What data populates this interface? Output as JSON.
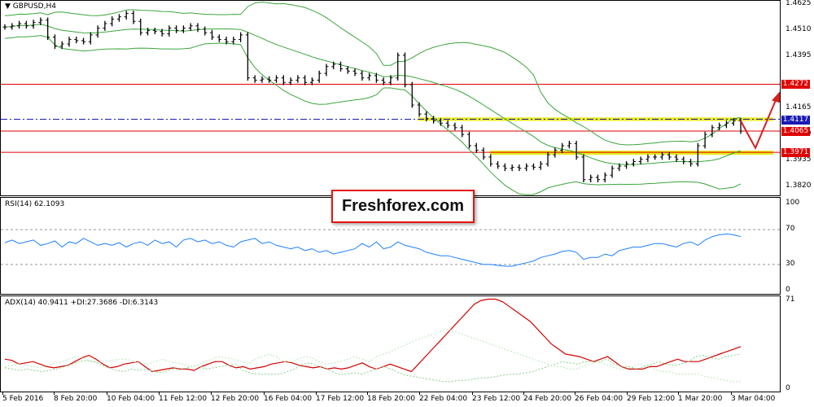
{
  "chart_data": [
    {
      "type": "candlestick",
      "title": "GBPUSD,H4",
      "x_labels": [
        "5 Feb 2016",
        "8 Feb 20:00",
        "10 Feb 04:00",
        "11 Feb 12:00",
        "12 Feb 20:00",
        "16 Feb 04:00",
        "17 Feb 12:00",
        "18 Feb 20:00",
        "22 Feb 04:00",
        "23 Feb 12:00",
        "24 Feb 20:00",
        "26 Feb 04:00",
        "29 Feb 12:00",
        "1 Mar 20:00",
        "3 Mar 04:00"
      ],
      "y_ticks": [
        1.4625,
        1.451,
        1.4395,
        1.4165,
        1.405,
        1.3935,
        1.382
      ],
      "ylim": [
        1.3795,
        1.463
      ],
      "close": [
        1.4525,
        1.453,
        1.454,
        1.453,
        1.4545,
        1.4555,
        1.448,
        1.444,
        1.445,
        1.447,
        1.4465,
        1.446,
        1.449,
        1.452,
        1.454,
        1.456,
        1.457,
        1.4585,
        1.455,
        1.45,
        1.451,
        1.4505,
        1.4495,
        1.452,
        1.451,
        1.452,
        1.453,
        1.4515,
        1.45,
        1.448,
        1.447,
        1.446,
        1.447,
        1.449,
        1.43,
        1.429,
        1.4295,
        1.429,
        1.43,
        1.428,
        1.429,
        1.43,
        1.428,
        1.429,
        1.432,
        1.435,
        1.436,
        1.434,
        1.433,
        1.432,
        1.43,
        1.431,
        1.429,
        1.428,
        1.43,
        1.44,
        1.427,
        1.418,
        1.414,
        1.412,
        1.411,
        1.41,
        1.409,
        1.408,
        1.405,
        1.4,
        1.398,
        1.395,
        1.392,
        1.391,
        1.39,
        1.3905,
        1.39,
        1.391,
        1.3905,
        1.392,
        1.396,
        1.398,
        1.4,
        1.401,
        1.395,
        1.385,
        1.386,
        1.385,
        1.387,
        1.39,
        1.391,
        1.392,
        1.393,
        1.394,
        1.395,
        1.395,
        1.396,
        1.395,
        1.394,
        1.393,
        1.392,
        1.4,
        1.405,
        1.408,
        1.409,
        1.41,
        1.411,
        1.4065
      ],
      "horizontal_lines": [
        {
          "value": 1.4272,
          "style": "solid",
          "color": "#e00000",
          "tag": "1.4272"
        },
        {
          "value": 1.4117,
          "style": "dashdot",
          "color": "#1a1ab3",
          "tag": "1.4117"
        },
        {
          "value": 1.4065,
          "style": "solid",
          "color": "#e00000",
          "tag": "1.4065"
        },
        {
          "value": 1.3971,
          "style": "solid",
          "color": "#e00000",
          "tag": "1.3971"
        }
      ],
      "zones": [
        {
          "from": 1.411,
          "to": 1.4125,
          "color": "#e8e800"
        },
        {
          "from": 1.396,
          "to": 1.3978,
          "color": "#e8e800"
        }
      ],
      "indicator": "Bollinger Bands",
      "colors": {
        "candles": "#000000",
        "bands": "#3aa63a",
        "arrow": "#d42020"
      }
    },
    {
      "type": "line",
      "title": "RSI(14) 62.1093",
      "ylim": [
        0,
        100
      ],
      "y_ticks": [
        100,
        70,
        30,
        0
      ],
      "levels": [
        70,
        30
      ],
      "values": [
        55,
        58,
        54,
        56,
        58,
        52,
        54,
        57,
        50,
        56,
        54,
        60,
        56,
        52,
        54,
        52,
        55,
        50,
        54,
        56,
        52,
        58,
        54,
        56,
        50,
        58,
        60,
        56,
        58,
        54,
        56,
        52,
        50,
        56,
        58,
        60,
        54,
        56,
        52,
        50,
        48,
        50,
        46,
        48,
        44,
        46,
        42,
        44,
        46,
        48,
        54,
        50,
        56,
        48,
        50,
        56,
        52,
        50,
        48,
        44,
        42,
        40,
        40,
        38,
        36,
        34,
        32,
        30,
        30,
        29,
        28,
        28,
        30,
        32,
        34,
        38,
        40,
        42,
        45,
        46,
        44,
        36,
        38,
        38,
        42,
        40,
        46,
        48,
        50,
        50,
        52,
        54,
        54,
        52,
        50,
        54,
        56,
        52,
        58,
        62,
        64,
        65,
        64,
        62
      ],
      "colors": {
        "line": "#1a7fff"
      }
    },
    {
      "type": "line",
      "title": "ADX(14) 40.9411 +DI:27.3686 -DI:6.3143",
      "ylim": [
        0,
        71
      ],
      "y_ticks": [
        71,
        0
      ],
      "series": [
        {
          "name": "ADX",
          "values": [
            24,
            23,
            20,
            21,
            22,
            20,
            18,
            17,
            18,
            19,
            22,
            25,
            27,
            24,
            20,
            17,
            18,
            20,
            21,
            22,
            18,
            14,
            15,
            16,
            17,
            16,
            16,
            15,
            18,
            20,
            22,
            22,
            19,
            17,
            18,
            16,
            17,
            18,
            20,
            21,
            22,
            21,
            19,
            18,
            17,
            18,
            16,
            17,
            16,
            17,
            19,
            21,
            18,
            16,
            18,
            20,
            18,
            16,
            14,
            20,
            26,
            32,
            38,
            44,
            50,
            56,
            62,
            68,
            71,
            72,
            72,
            70,
            66,
            62,
            58,
            54,
            48,
            42,
            36,
            32,
            28,
            27,
            26,
            24,
            22,
            24,
            26,
            22,
            18,
            16,
            16,
            16,
            18,
            18,
            20,
            22,
            24,
            22,
            22,
            22,
            24,
            26,
            28,
            30,
            32,
            34
          ]
        },
        {
          "name": "+DI",
          "values": [
            17,
            16,
            15,
            16,
            15,
            14,
            15,
            16,
            18,
            20,
            22,
            23,
            22,
            19,
            17,
            15,
            14,
            16,
            15,
            16,
            14,
            13,
            15,
            17,
            16,
            18,
            19,
            16,
            17,
            18,
            19,
            20,
            15,
            13,
            12,
            12,
            12,
            12,
            14,
            16,
            20,
            21,
            19,
            17,
            14,
            12,
            12,
            13,
            12,
            14,
            16,
            18,
            16,
            13,
            11,
            10,
            9,
            8,
            7,
            6,
            6,
            7,
            7,
            8,
            9,
            9,
            10,
            11,
            12,
            12,
            13,
            14,
            16,
            18,
            20,
            22,
            21,
            20,
            22,
            22,
            22,
            24,
            20,
            18,
            18,
            16,
            18,
            20,
            22,
            20,
            19,
            20,
            22,
            26,
            27,
            25,
            24,
            26,
            27,
            28
          ]
        },
        {
          "name": "-DI",
          "values": [
            18,
            19,
            20,
            19,
            18,
            17,
            19,
            21,
            22,
            24,
            26,
            25,
            22,
            21,
            22,
            23,
            24,
            24,
            22,
            21,
            20,
            22,
            24,
            22,
            21,
            20,
            18,
            19,
            22,
            24,
            26,
            25,
            24,
            22,
            20,
            24,
            26,
            28,
            26,
            22,
            22,
            24,
            26,
            25,
            22,
            20,
            21,
            22,
            24,
            26,
            24,
            22,
            26,
            28,
            30,
            33,
            35,
            38,
            40,
            42,
            44,
            46,
            48,
            46,
            44,
            42,
            40,
            38,
            36,
            34,
            32,
            30,
            28,
            26,
            24,
            22,
            20,
            18,
            18,
            16,
            16,
            18,
            20,
            22,
            20,
            18,
            16,
            16,
            18,
            20,
            18,
            16,
            14,
            14,
            12,
            12,
            12,
            12,
            10,
            9,
            8,
            7,
            6,
            6
          ]
        }
      ],
      "colors": {
        "ADX": "#d40000",
        "+DI": "#88d088",
        "-DI": "#b8e8b8"
      }
    }
  ]
}
